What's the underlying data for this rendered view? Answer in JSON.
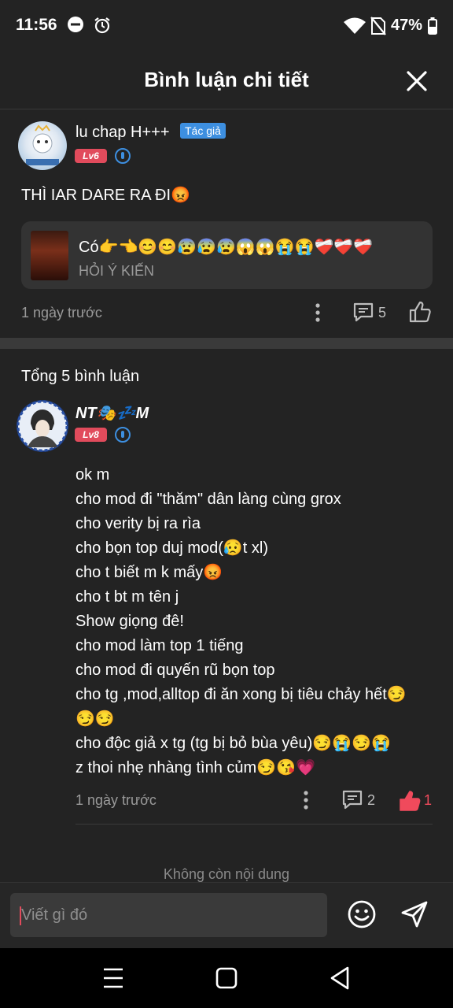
{
  "status_bar": {
    "time": "11:56",
    "battery": "47%"
  },
  "header": {
    "title": "Bình luận chi tiết"
  },
  "post": {
    "username": "lu chap H+++",
    "author_badge": "Tác giả",
    "level": "Lv6",
    "text": "THÌ IAR DARE RA ĐI😡",
    "quote": {
      "line1": "Có👉👈😊😊😰😰😰😱😱😭😭❤️‍🩹❤️‍🩹❤️‍🩹",
      "line2": "HỎI Ý KIẾN"
    },
    "time": "1 ngày trước",
    "comment_count": "5"
  },
  "comments_section": {
    "total_label": "Tổng 5 bình luận"
  },
  "comment": {
    "username": "NT🎭💤M",
    "level": "Lv8",
    "lines": [
      "ok m",
      "cho mod đi \"thăm\" dân làng cùng grox",
      "cho verity bị ra rìa",
      "cho bọn top duj mod(😥t xl)",
      "cho t biết m k mấy😡",
      "cho t bt m tên j",
      "Show giọng đê!",
      "cho mod làm top 1 tiếng",
      "cho mod đi quyến rũ bọn top",
      "cho tg ,mod,alltop đi ăn xong bị tiêu chảy hết😏",
      "😏😏",
      "cho độc giả x tg (tg bị bỏ bùa yêu)😏😭😏😭",
      "z thoi nhẹ nhàng tình củm😏😘💗"
    ],
    "time": "1 ngày trước",
    "reply_count": "2",
    "like_count": "1"
  },
  "end_text": "Không còn nội dung",
  "composer": {
    "placeholder": "Viết gì đó"
  },
  "colors": {
    "background": "#232323",
    "accent_blue": "#3d8fe0",
    "like_red": "#f04a5c",
    "level_badge": "#e14b5c"
  },
  "icons": [
    "dnd-icon",
    "alarm-icon",
    "wifi-icon",
    "no-sim-icon",
    "battery-icon",
    "close-icon",
    "more-icon",
    "comment-icon",
    "like-icon",
    "emoji-icon",
    "send-icon",
    "menu-nav-icon",
    "home-nav-icon",
    "back-nav-icon"
  ]
}
